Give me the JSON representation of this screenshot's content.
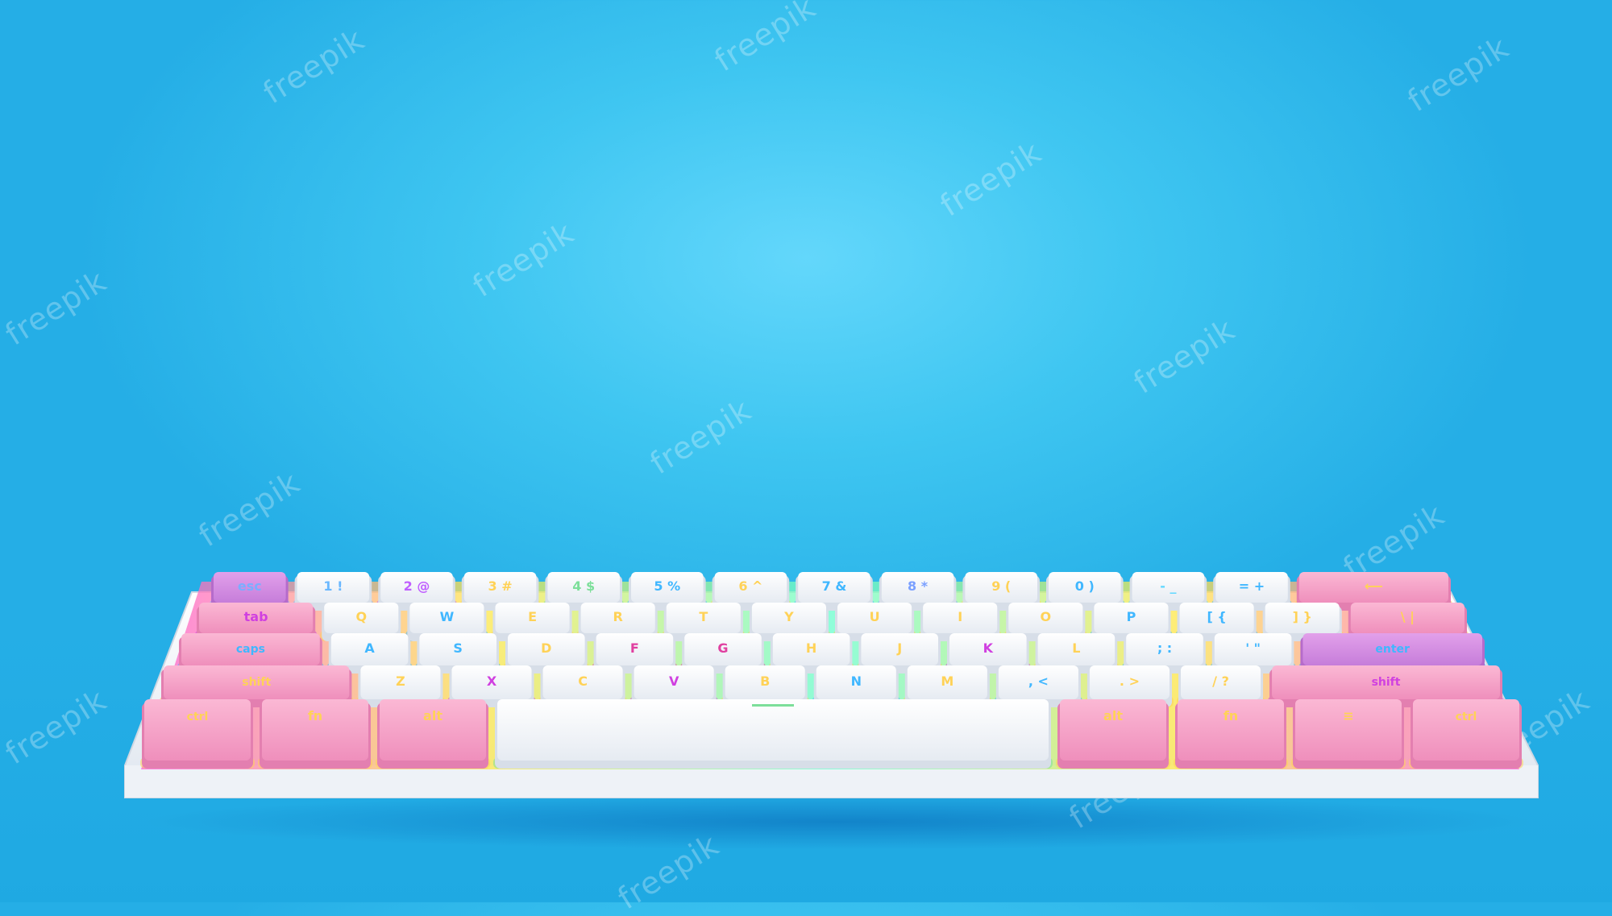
{
  "scene": {
    "background_color": "#3fc6f1",
    "keyboard_frame_color": "#f3f5f8",
    "pink_keycap_color": "#f6a6c8",
    "purple_keycap_color": "#d48fe0",
    "white_keycap_color": "#f8f8fb"
  },
  "watermark": {
    "text": "freepik"
  },
  "keyboard": {
    "rows": [
      [
        {
          "label": "esc",
          "cap": "purple",
          "legend": "#7aaeff",
          "units": 1
        },
        {
          "label": "1 !",
          "cap": "white",
          "legend": "#6ab8ff",
          "units": 1
        },
        {
          "label": "2 @",
          "cap": "white",
          "legend": "#c060ff",
          "units": 1
        },
        {
          "label": "3 #",
          "cap": "white",
          "legend": "#ffd257",
          "units": 1
        },
        {
          "label": "4 $",
          "cap": "white",
          "legend": "#7ddf9a",
          "units": 1
        },
        {
          "label": "5 %",
          "cap": "white",
          "legend": "#40b7ff",
          "units": 1
        },
        {
          "label": "6 ^",
          "cap": "white",
          "legend": "#ffd257",
          "units": 1
        },
        {
          "label": "7 &",
          "cap": "white",
          "legend": "#40b7ff",
          "units": 1
        },
        {
          "label": "8 *",
          "cap": "white",
          "legend": "#7aa0ff",
          "units": 1
        },
        {
          "label": "9 (",
          "cap": "white",
          "legend": "#ffd257",
          "units": 1
        },
        {
          "label": "0 )",
          "cap": "white",
          "legend": "#40b7ff",
          "units": 1
        },
        {
          "label": "- _",
          "cap": "white",
          "legend": "#60d8ff",
          "units": 1
        },
        {
          "label": "= +",
          "cap": "white",
          "legend": "#40b7ff",
          "units": 1
        },
        {
          "label": "⟵",
          "cap": "pink",
          "legend": "#ffd257",
          "units": 2
        }
      ],
      [
        {
          "label": "tab",
          "cap": "pink",
          "legend": "#d040e0",
          "units": 1.5
        },
        {
          "label": "Q",
          "cap": "white",
          "legend": "#ffd257",
          "units": 1
        },
        {
          "label": "W",
          "cap": "white",
          "legend": "#40b7ff",
          "units": 1
        },
        {
          "label": "E",
          "cap": "white",
          "legend": "#ffd257",
          "units": 1
        },
        {
          "label": "R",
          "cap": "white",
          "legend": "#ffd257",
          "units": 1
        },
        {
          "label": "T",
          "cap": "white",
          "legend": "#ffd257",
          "units": 1
        },
        {
          "label": "Y",
          "cap": "white",
          "legend": "#ffd257",
          "units": 1
        },
        {
          "label": "U",
          "cap": "white",
          "legend": "#ffd257",
          "units": 1
        },
        {
          "label": "I",
          "cap": "white",
          "legend": "#ffd257",
          "units": 1
        },
        {
          "label": "O",
          "cap": "white",
          "legend": "#ffd257",
          "units": 1
        },
        {
          "label": "P",
          "cap": "white",
          "legend": "#40b7ff",
          "units": 1
        },
        {
          "label": "[ {",
          "cap": "white",
          "legend": "#40b7ff",
          "units": 1
        },
        {
          "label": "] }",
          "cap": "white",
          "legend": "#ffd257",
          "units": 1
        },
        {
          "label": "\\ |",
          "cap": "pink",
          "legend": "#ffd257",
          "units": 1.5
        }
      ],
      [
        {
          "label": "caps",
          "cap": "pink",
          "legend": "#40b7ff",
          "units": 1.75
        },
        {
          "label": "A",
          "cap": "white",
          "legend": "#40b7ff",
          "units": 1
        },
        {
          "label": "S",
          "cap": "white",
          "legend": "#40b7ff",
          "units": 1
        },
        {
          "label": "D",
          "cap": "white",
          "legend": "#ffd257",
          "units": 1
        },
        {
          "label": "F",
          "cap": "white",
          "legend": "#e040a0",
          "units": 1
        },
        {
          "label": "G",
          "cap": "white",
          "legend": "#e040a0",
          "units": 1
        },
        {
          "label": "H",
          "cap": "white",
          "legend": "#ffd257",
          "units": 1
        },
        {
          "label": "J",
          "cap": "white",
          "legend": "#ffd257",
          "units": 1
        },
        {
          "label": "K",
          "cap": "white",
          "legend": "#d040e0",
          "units": 1
        },
        {
          "label": "L",
          "cap": "white",
          "legend": "#ffd257",
          "units": 1
        },
        {
          "label": "; :",
          "cap": "white",
          "legend": "#40b7ff",
          "units": 1
        },
        {
          "label": "' \"",
          "cap": "white",
          "legend": "#40b7ff",
          "units": 1
        },
        {
          "label": "enter",
          "cap": "purple",
          "legend": "#40b7ff",
          "units": 2.25
        }
      ],
      [
        {
          "label": "shift",
          "cap": "pink",
          "legend": "#ffd257",
          "units": 2.25
        },
        {
          "label": "Z",
          "cap": "white",
          "legend": "#ffd257",
          "units": 1
        },
        {
          "label": "X",
          "cap": "white",
          "legend": "#d040e0",
          "units": 1
        },
        {
          "label": "C",
          "cap": "white",
          "legend": "#ffd257",
          "units": 1
        },
        {
          "label": "V",
          "cap": "white",
          "legend": "#d040e0",
          "units": 1
        },
        {
          "label": "B",
          "cap": "white",
          "legend": "#ffd257",
          "units": 1
        },
        {
          "label": "N",
          "cap": "white",
          "legend": "#40b7ff",
          "units": 1
        },
        {
          "label": "M",
          "cap": "white",
          "legend": "#ffd257",
          "units": 1
        },
        {
          "label": ", <",
          "cap": "white",
          "legend": "#40b7ff",
          "units": 1
        },
        {
          "label": ". >",
          "cap": "white",
          "legend": "#ffd257",
          "units": 1
        },
        {
          "label": "/ ?",
          "cap": "white",
          "legend": "#ffd257",
          "units": 1
        },
        {
          "label": "shift",
          "cap": "pink",
          "legend": "#d040e0",
          "units": 2.75
        }
      ],
      [
        {
          "label": "ctrl",
          "cap": "pink",
          "legend": "#ffd257",
          "units": 1.25
        },
        {
          "label": "fn",
          "cap": "pink",
          "legend": "#ffd257",
          "units": 1.25
        },
        {
          "label": "alt",
          "cap": "pink",
          "legend": "#ffd257",
          "units": 1.25
        },
        {
          "label": "",
          "cap": "white",
          "legend": "#7ddf9a",
          "units": 6.25
        },
        {
          "label": "alt",
          "cap": "pink",
          "legend": "#ffd257",
          "units": 1.25
        },
        {
          "label": "fn",
          "cap": "pink",
          "legend": "#ffd257",
          "units": 1.25
        },
        {
          "label": "≡",
          "cap": "pink",
          "legend": "#ffd257",
          "units": 1.25
        },
        {
          "label": "ctrl",
          "cap": "pink",
          "legend": "#ffd257",
          "units": 1.25
        }
      ]
    ]
  }
}
